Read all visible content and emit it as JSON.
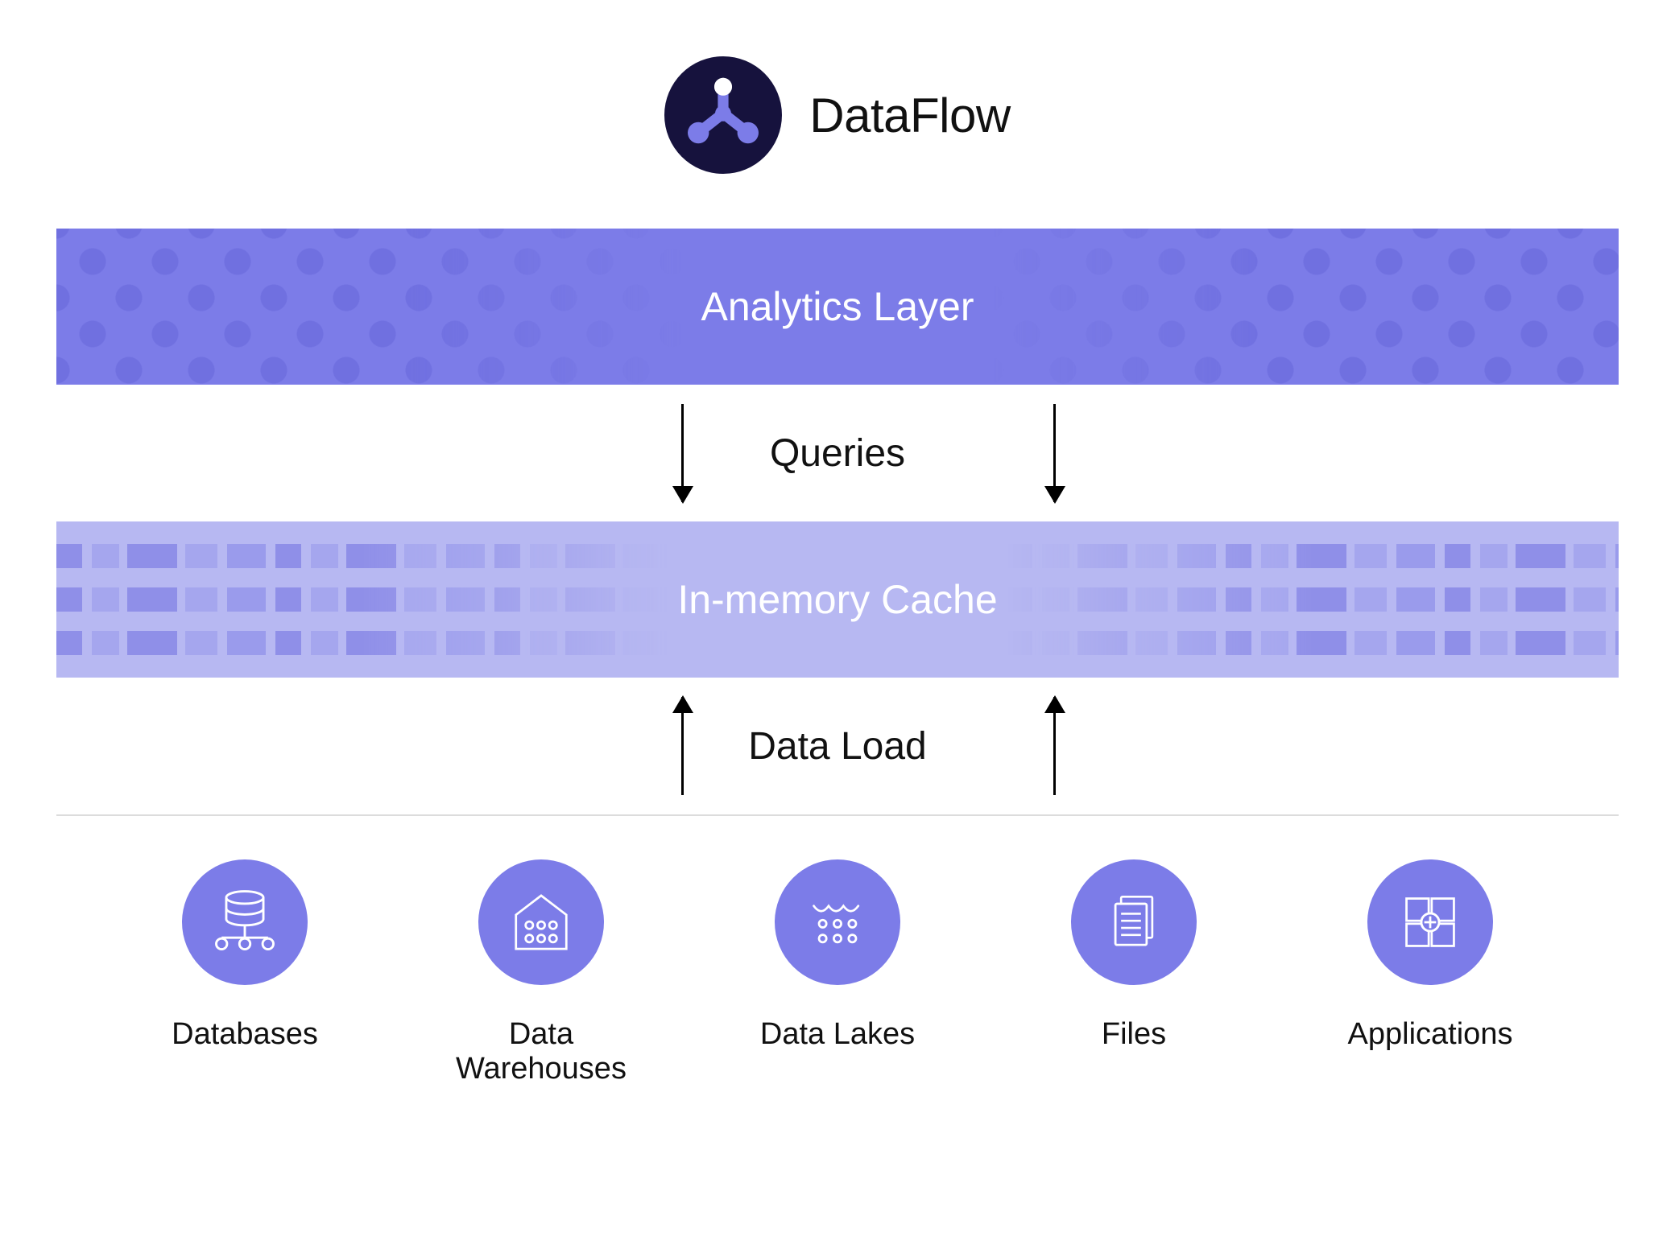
{
  "brand": {
    "name": "DataFlow"
  },
  "layers": {
    "analytics": "Analytics Layer",
    "cache": "In-memory Cache"
  },
  "flows": {
    "queries": "Queries",
    "load": "Data Load"
  },
  "sources": [
    {
      "id": "databases",
      "label": "Databases"
    },
    {
      "id": "warehouses",
      "label": "Data Warehouses"
    },
    {
      "id": "lakes",
      "label": "Data Lakes"
    },
    {
      "id": "files",
      "label": "Files"
    },
    {
      "id": "apps",
      "label": "Applications"
    }
  ],
  "colors": {
    "primary": "#7c7ce8",
    "primaryLight": "#b7b8f2",
    "logoBg": "#16123d",
    "text": "#111111"
  }
}
